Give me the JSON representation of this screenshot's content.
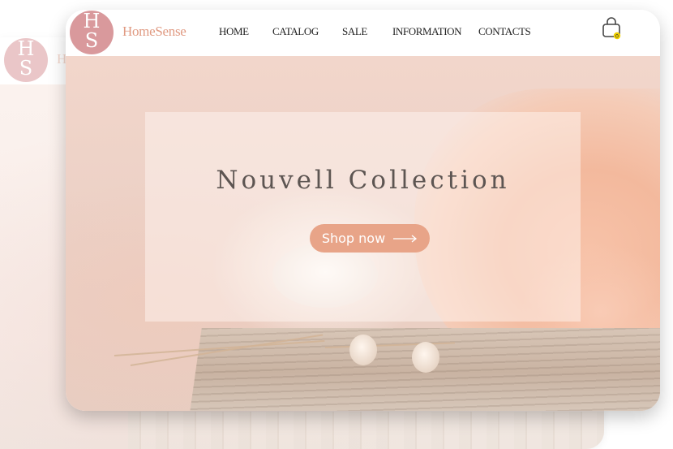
{
  "brand": {
    "logo_top": "H",
    "logo_bottom": "S",
    "name": "HomeSense",
    "ghost_name": "H"
  },
  "nav": {
    "items": [
      "HOME",
      "CATALOG",
      "SALE",
      "INFORMATION",
      "CONTACTS"
    ]
  },
  "cart": {
    "icon": "shopping-bag-icon",
    "badge_count": "0",
    "badge_color": "#f0d000"
  },
  "hero": {
    "title": "Nouvell Collection",
    "cta_label": "Shop now",
    "cta_icon": "long-arrow-right-icon"
  },
  "colors": {
    "accent": "#e8a488",
    "brand": "#e09a82",
    "logo_bg": "#d9999c"
  }
}
